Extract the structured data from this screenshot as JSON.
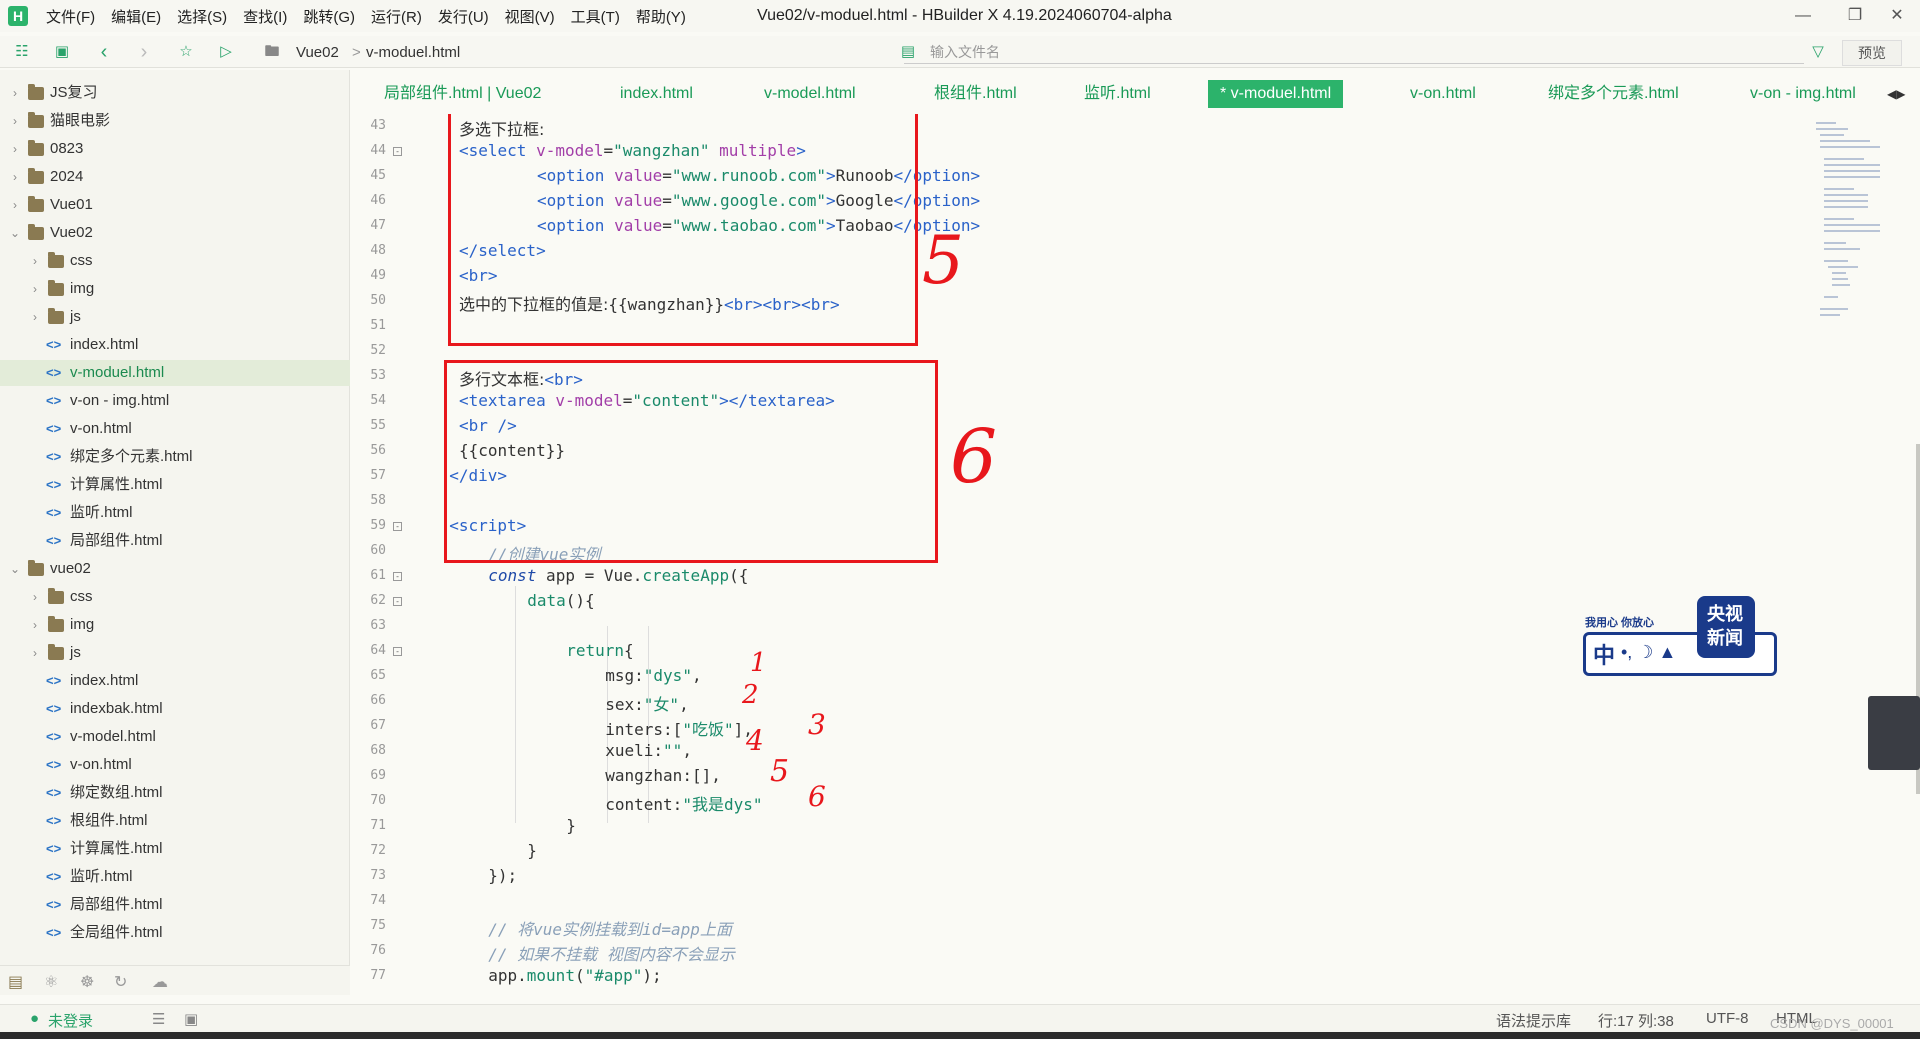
{
  "app": {
    "title": "Vue02/v-moduel.html - HBuilder X 4.19.2024060704-alpha",
    "logo_letter": "H",
    "menu": [
      "文件(F)",
      "编辑(E)",
      "选择(S)",
      "查找(I)",
      "跳转(G)",
      "运行(R)",
      "发行(U)",
      "视图(V)",
      "工具(T)",
      "帮助(Y)"
    ]
  },
  "toolbar": {
    "breadcrumb": [
      "Vue02",
      "v-moduel.html"
    ],
    "search_placeholder": "输入文件名",
    "preview_label": "预览"
  },
  "sidebar": {
    "items": [
      {
        "label": "JS复习",
        "kind": "folder",
        "expanded": false
      },
      {
        "label": "猫眼电影",
        "kind": "folder",
        "expanded": false
      },
      {
        "label": "0823",
        "kind": "folder",
        "expanded": false
      },
      {
        "label": "2024",
        "kind": "folder",
        "expanded": false
      },
      {
        "label": "Vue01",
        "kind": "folder",
        "expanded": false
      },
      {
        "label": "Vue02",
        "kind": "folder",
        "expanded": true
      },
      {
        "label": "css",
        "kind": "folder",
        "expanded": false
      },
      {
        "label": "img",
        "kind": "folder",
        "expanded": false
      },
      {
        "label": "js",
        "kind": "folder",
        "expanded": false
      },
      {
        "label": "index.html",
        "kind": "file"
      },
      {
        "label": "v-moduel.html",
        "kind": "file",
        "active": true
      },
      {
        "label": "v-on - img.html",
        "kind": "file"
      },
      {
        "label": "v-on.html",
        "kind": "file"
      },
      {
        "label": "绑定多个元素.html",
        "kind": "file"
      },
      {
        "label": "计算属性.html",
        "kind": "file"
      },
      {
        "label": "监听.html",
        "kind": "file"
      },
      {
        "label": "局部组件.html",
        "kind": "file"
      },
      {
        "label": "vue02",
        "kind": "folder",
        "expanded": true
      },
      {
        "label": "css",
        "kind": "folder",
        "expanded": false
      },
      {
        "label": "img",
        "kind": "folder",
        "expanded": false
      },
      {
        "label": "js",
        "kind": "folder",
        "expanded": false
      },
      {
        "label": "index.html",
        "kind": "file"
      },
      {
        "label": "indexbak.html",
        "kind": "file"
      },
      {
        "label": "v-model.html",
        "kind": "file"
      },
      {
        "label": "v-on.html",
        "kind": "file"
      },
      {
        "label": "绑定数组.html",
        "kind": "file"
      },
      {
        "label": "根组件.html",
        "kind": "file"
      },
      {
        "label": "计算属性.html",
        "kind": "file"
      },
      {
        "label": "监听.html",
        "kind": "file"
      },
      {
        "label": "局部组件.html",
        "kind": "file"
      },
      {
        "label": "全局组件.html",
        "kind": "file"
      }
    ]
  },
  "tabs": [
    {
      "label": "局部组件.html | Vue02",
      "active": false
    },
    {
      "label": "index.html",
      "active": false
    },
    {
      "label": "v-model.html",
      "active": false
    },
    {
      "label": "根组件.html",
      "active": false
    },
    {
      "label": "监听.html",
      "active": false
    },
    {
      "label": "* v-moduel.html",
      "active": true
    },
    {
      "label": "v-on.html",
      "active": false
    },
    {
      "label": "绑定多个元素.html",
      "active": false
    },
    {
      "label": "v-on - img.html",
      "active": false
    }
  ],
  "editor": {
    "lines": [
      {
        "n": "43",
        "fold": false,
        "indent": 1,
        "html": "<span class=\"cn\">多选下拉框:</span>"
      },
      {
        "n": "44",
        "fold": true,
        "indent": 1,
        "html": "<span class=\"tag\">&lt;select</span> <span class=\"attr\">v-model</span>=<span class=\"str\">\"wangzhan\"</span> <span class=\"attr\">multiple</span><span class=\"tag\">&gt;</span>"
      },
      {
        "n": "45",
        "fold": false,
        "indent": 3,
        "html": "<span class=\"tag\">&lt;option</span> <span class=\"attr\">value</span>=<span class=\"str\">\"www.runoob.com\"</span><span class=\"tag\">&gt;</span>Runoob<span class=\"tag\">&lt;/option&gt;</span>"
      },
      {
        "n": "46",
        "fold": false,
        "indent": 3,
        "html": "<span class=\"tag\">&lt;option</span> <span class=\"attr\">value</span>=<span class=\"str\">\"www.google.com\"</span><span class=\"tag\">&gt;</span>Google<span class=\"tag\">&lt;/option&gt;</span>"
      },
      {
        "n": "47",
        "fold": false,
        "indent": 3,
        "html": "<span class=\"tag\">&lt;option</span> <span class=\"attr\">value</span>=<span class=\"str\">\"www.taobao.com\"</span><span class=\"tag\">&gt;</span>Taobao<span class=\"tag\">&lt;/option&gt;</span>"
      },
      {
        "n": "48",
        "fold": false,
        "indent": 1,
        "html": "<span class=\"tag\">&lt;/select&gt;</span>"
      },
      {
        "n": "49",
        "fold": false,
        "indent": 1,
        "html": "<span class=\"tag\">&lt;br&gt;</span>"
      },
      {
        "n": "50",
        "fold": false,
        "indent": 1,
        "html": "<span class=\"cn\">选中的下拉框的值是:</span>{{wangzhan}}<span class=\"tag\">&lt;br&gt;&lt;br&gt;&lt;br&gt;</span>"
      },
      {
        "n": "51",
        "fold": false,
        "indent": 0,
        "html": ""
      },
      {
        "n": "52",
        "fold": false,
        "indent": 0,
        "html": ""
      },
      {
        "n": "53",
        "fold": false,
        "indent": 1,
        "html": "<span class=\"cn\">多行文本框:</span><span class=\"tag\">&lt;br&gt;</span>"
      },
      {
        "n": "54",
        "fold": false,
        "indent": 1,
        "html": "<span class=\"tag\">&lt;textarea</span> <span class=\"attr\">v-model</span>=<span class=\"str\">\"content\"</span><span class=\"tag\">&gt;&lt;/textarea&gt;</span>"
      },
      {
        "n": "55",
        "fold": false,
        "indent": 1,
        "html": "<span class=\"tag\">&lt;br /&gt;</span>"
      },
      {
        "n": "56",
        "fold": false,
        "indent": 1,
        "html": "{{content}}"
      },
      {
        "n": "57",
        "fold": false,
        "indent": 0.75,
        "html": "<span class=\"tag\">&lt;/div&gt;</span>"
      },
      {
        "n": "58",
        "fold": false,
        "indent": 0,
        "html": ""
      },
      {
        "n": "59",
        "fold": true,
        "indent": 0.75,
        "html": "<span class=\"tag\">&lt;script&gt;</span>"
      },
      {
        "n": "60",
        "fold": false,
        "indent": 1.75,
        "html": "<span class=\"cmt\">//创建vue实例</span>"
      },
      {
        "n": "61",
        "fold": true,
        "indent": 1.75,
        "html": "<span class=\"kw\">const</span> app = Vue.<span class=\"fn\">createApp</span>({"
      },
      {
        "n": "62",
        "fold": true,
        "indent": 2.75,
        "html": "<span class=\"fn\">data</span>(){"
      },
      {
        "n": "63",
        "fold": false,
        "indent": 0,
        "html": ""
      },
      {
        "n": "64",
        "fold": true,
        "indent": 3.75,
        "html": "<span class=\"fn\">return</span>{"
      },
      {
        "n": "65",
        "fold": false,
        "indent": 4.75,
        "html": "msg:<span class=\"str\">\"dys\"</span>,"
      },
      {
        "n": "66",
        "fold": false,
        "indent": 4.75,
        "html": "sex:<span class=\"str\">\"女\"</span>,"
      },
      {
        "n": "67",
        "fold": false,
        "indent": 4.75,
        "html": "inters:[<span class=\"str\">\"吃饭\"</span>],"
      },
      {
        "n": "68",
        "fold": false,
        "indent": 4.75,
        "html": "xueli:<span class=\"str\">\"\"</span>,"
      },
      {
        "n": "69",
        "fold": false,
        "indent": 4.75,
        "html": "wangzhan:[],"
      },
      {
        "n": "70",
        "fold": false,
        "indent": 4.75,
        "html": "content:<span class=\"str\">\"我是dys\"</span>"
      },
      {
        "n": "71",
        "fold": false,
        "indent": 3.75,
        "html": "}"
      },
      {
        "n": "72",
        "fold": false,
        "indent": 2.75,
        "html": "}"
      },
      {
        "n": "73",
        "fold": false,
        "indent": 1.75,
        "html": "});"
      },
      {
        "n": "74",
        "fold": false,
        "indent": 0,
        "html": ""
      },
      {
        "n": "75",
        "fold": false,
        "indent": 1.75,
        "html": "<span class=\"cmt\">// 将vue实例挂载到id=app上面</span>"
      },
      {
        "n": "76",
        "fold": false,
        "indent": 1.75,
        "html": "<span class=\"cmt\">// 如果不挂载 视图内容不会显示</span>"
      },
      {
        "n": "77",
        "fold": false,
        "indent": 1.75,
        "html": "app.<span class=\"fn\">mount</span>(<span class=\"str\">\"#app\"</span>);"
      }
    ]
  },
  "annotations": {
    "box1_number": "5",
    "box2_number": "6",
    "marks": [
      "1",
      "2",
      "3",
      "4",
      "5",
      "6"
    ]
  },
  "watermark": {
    "slogan": "我用心 你放心",
    "brand_top": "央视",
    "brand_bottom": "新闻",
    "emblem": "中"
  },
  "statusbar": {
    "login": "未登录",
    "syntax": "语法提示库",
    "position": "行:17  列:38",
    "encoding": "UTF-8",
    "lang": "HTML",
    "credit": "CSDN @DYS_00001"
  },
  "colors": {
    "accent": "#2cb36b",
    "annotation_red": "#e8171c",
    "tag_blue": "#2a62c9",
    "attr_purple": "#a23ea8",
    "string_green": "#1a8a6a"
  }
}
